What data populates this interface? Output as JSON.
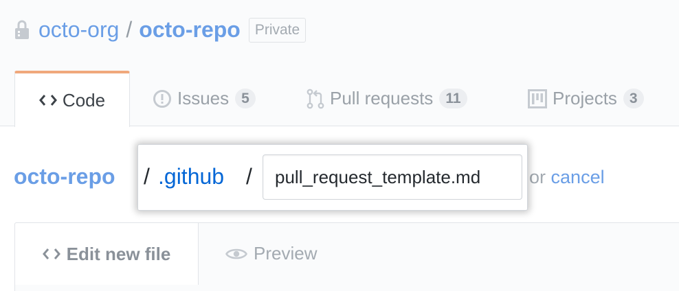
{
  "repo": {
    "owner": "octo-org",
    "separator": "/",
    "name": "octo-repo",
    "visibility_label": "Private"
  },
  "tabs": [
    {
      "label": "Code",
      "icon": "code-icon",
      "selected": true
    },
    {
      "label": "Issues",
      "icon": "issue-opened-icon",
      "count": "5"
    },
    {
      "label": "Pull requests",
      "icon": "git-pull-request-icon",
      "count": "11"
    },
    {
      "label": "Projects",
      "icon": "project-icon",
      "count": "3"
    }
  ],
  "file_path": {
    "repo": "octo-repo",
    "separator": "/",
    "folder": ".github",
    "filename_value": "pull_request_template.md",
    "or_text": "or",
    "cancel_label": "cancel"
  },
  "editor": {
    "tabs": [
      {
        "label": "Edit new file",
        "icon": "code-icon",
        "active": true
      },
      {
        "label": "Preview",
        "icon": "eye-icon",
        "active": false
      }
    ]
  },
  "colors": {
    "link": "#0366d6",
    "faded_link": "#6a9ee6",
    "selected_tab_accent": "#f0a87c",
    "header_background": "#fafbfc"
  }
}
